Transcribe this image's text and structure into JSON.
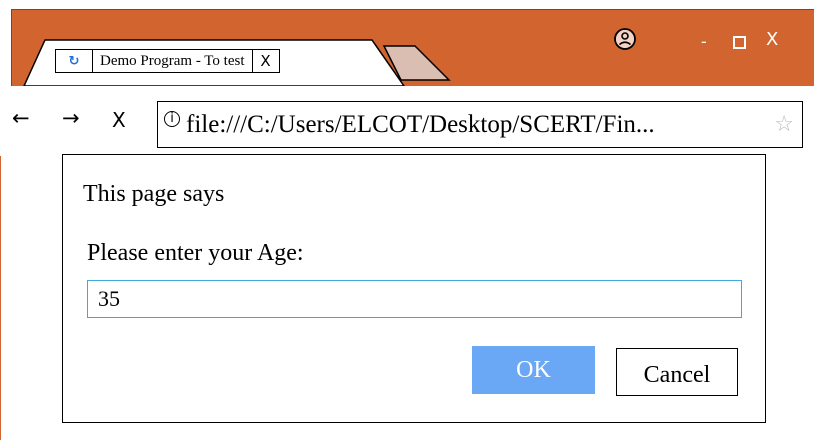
{
  "browser": {
    "tab": {
      "favicon": "reload-icon",
      "favicon_glyph": "↻",
      "title": "Demo Program - To test",
      "close_label": "X"
    },
    "window_controls": {
      "profile_icon": "profile-icon",
      "minimize_label": "-",
      "close_label": "X"
    },
    "toolbar": {
      "back_label": "←",
      "forward_label": "→",
      "stop_label": "X",
      "info_icon_glyph": "i",
      "url": "file:///C:/Users/ELCOT/Desktop/SCERT/Fin...",
      "star_glyph": "☆"
    },
    "colors": {
      "titlebar": "#d2652f",
      "ok_button": "#6aa8f5",
      "input_border": "#3fa9d8"
    }
  },
  "dialog": {
    "title": "This page says",
    "prompt": "Please enter your Age:",
    "input_value": "35",
    "ok_label": "OK",
    "cancel_label": "Cancel"
  }
}
